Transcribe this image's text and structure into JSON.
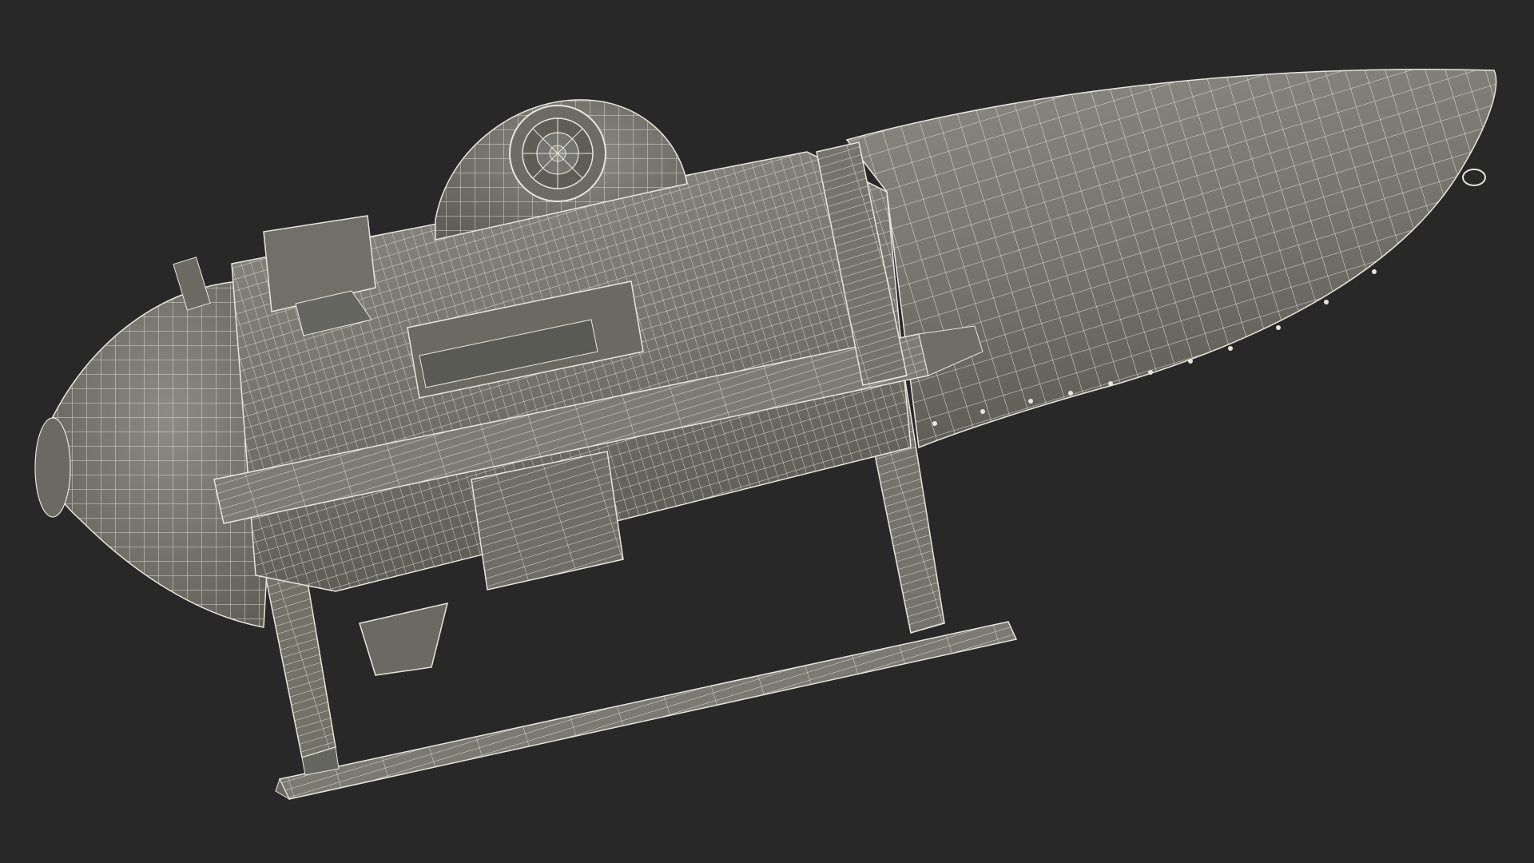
{
  "scene": {
    "subject": "submersible-wireframe-render",
    "render_style": "wireframe-over-shaded",
    "colors": {
      "background": "#282828",
      "surface": "#7a7a72",
      "surface_dark": "#5c5c55",
      "surface_light": "#8e8e86",
      "wire": "#e6e6de",
      "shadow": "#3f3f3a"
    }
  }
}
